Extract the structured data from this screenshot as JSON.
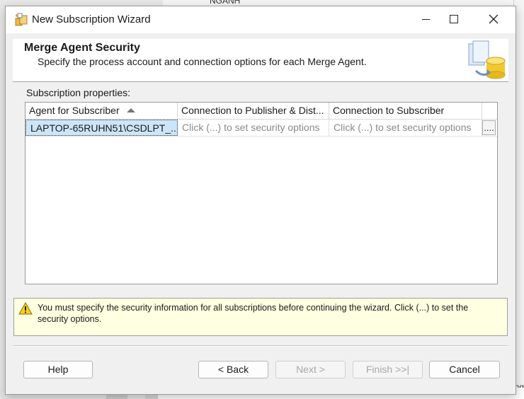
{
  "background": {
    "top_text": "NGANH",
    "right_text": "ng"
  },
  "window": {
    "title": "New Subscription Wizard"
  },
  "header": {
    "title": "Merge Agent Security",
    "subtitle": "Specify the process account and connection options for each Merge Agent."
  },
  "subscriptions": {
    "label": "Subscription properties:",
    "columns": [
      "Agent for Subscriber",
      "Connection to Publisher & Dist...",
      "Connection to Subscriber"
    ],
    "rows": [
      {
        "agent": "LAPTOP-65RUHN51\\CSDLPT_...",
        "publisher_conn": "Click (...) to set security options",
        "subscriber_conn": "Click (...) to set security options",
        "ellipsis": "...."
      }
    ]
  },
  "warning": {
    "text": "You must specify the security information for all subscriptions before continuing the wizard. Click (...) to set the security options."
  },
  "buttons": {
    "help": "Help",
    "back": "< Back",
    "next": "Next >",
    "finish": "Finish >>|",
    "cancel": "Cancel"
  }
}
